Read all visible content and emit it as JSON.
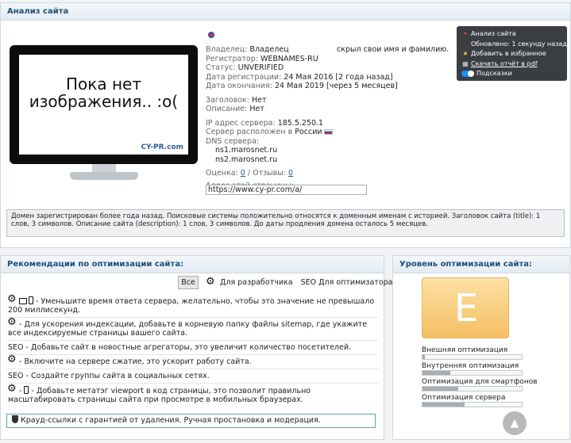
{
  "analysis": {
    "title": "Анализ сайта",
    "screenshot_text": "Пока нет изображения.. :o(",
    "screenshot_watermark": "CY-PR.com",
    "owner_label": "Владелец:",
    "owner_value": "Владелец                    скрыл свои имя и фамилию.",
    "registrar_label": "Регистратор:",
    "registrar_value": "WEBNAMES-RU",
    "status_label": "Статус:",
    "status_value": "UNVERIFIED",
    "reg_date_label": "Дата регистрации:",
    "reg_date_value": "24 Мая 2016 [2 года назад]",
    "exp_date_label": "Дата окончания:",
    "exp_date_value": "24 Мая 2019 [через 5 месяцев]",
    "title_label": "Заголовок:",
    "title_value": "Нет",
    "desc_label": "Описание:",
    "desc_value": "Нет",
    "ip_label": "IP адрес сервера:",
    "ip_value": "185.5.250.1",
    "location_label": "Сервер расположен в",
    "location_value": "России",
    "dns_label": "DNS сервера:",
    "dns": [
      "ns1.marosnet.ru",
      "ns2.marosnet.ru"
    ],
    "rating_label": "Оценка:",
    "rating_value": "0",
    "reviews_label": "/ Отзывы:",
    "reviews_value": "0",
    "page_addr_label": "Адрес этой страницы:",
    "page_addr_value": "https://www.cy-pr.com/a/",
    "notice": "Домен зарегистрирован более года назад. Поисковые системы положительно относятся к доменным именам с историей. Заголовок сайта (title): 1 слов, 3 символов. Описание сайта (description): 1 слов, 3 символов. До даты продления домена осталось 5 месяцев."
  },
  "menu": {
    "items": [
      {
        "label": "Анализ сайта",
        "icon": "pulse-icon"
      },
      {
        "label": "Обновлено: 1 секунду назад",
        "icon": ""
      },
      {
        "label": "Добавить в избранное",
        "icon": "star-icon"
      },
      {
        "label": "Скачать отчёт в pdf",
        "icon": "pdf-icon"
      },
      {
        "label": "Подсказки",
        "icon": "toggle-icon"
      }
    ]
  },
  "recs": {
    "title": "Рекомендации по оптимизации сайта:",
    "tab_all": "Все",
    "tab_dev": "Для разработчика",
    "tab_seo": "SEO Для оптимизатора",
    "items": [
      "- Уменьшите время ответа сервера, желательно, чтобы это значение не превышало 200 миллисекунд.",
      "- Для ускорения индексации, добавьте в корневую папку файлы sitemap, где укажите все индексируемые страницы вашего сайта.",
      "SEO - Добавьте сайт в новостные агрегаторы, это увеличит количество посетителей.",
      "- Включите на сервере сжатие, это ускорит работу сайта.",
      "SEO - Создайте группы сайта в социальных сетях.",
      "- Добавьте метатэг viewport в код страницы, это позволит правильно масштабировать страницы сайта при просмотре в мобильных браузерах."
    ],
    "crowd": "Крауд-ссылки с гарантией от удаления. Ручная простановка и модерация."
  },
  "level": {
    "title": "Уровень оптимизации сайта:",
    "grade": "E",
    "bars": [
      {
        "label": "Внешняя оптимизация",
        "value": 0.02
      },
      {
        "label": "Внутренняя оптимизация",
        "value": 0.28
      },
      {
        "label": "Оптимизация для смартфонов",
        "value": 0.36
      },
      {
        "label": "Оптимизация сервера",
        "value": 0.42
      }
    ]
  },
  "colors": {
    "accent": "#1e4f7a",
    "grade_bg": "#f4bf63",
    "link": "#1a56b0"
  }
}
